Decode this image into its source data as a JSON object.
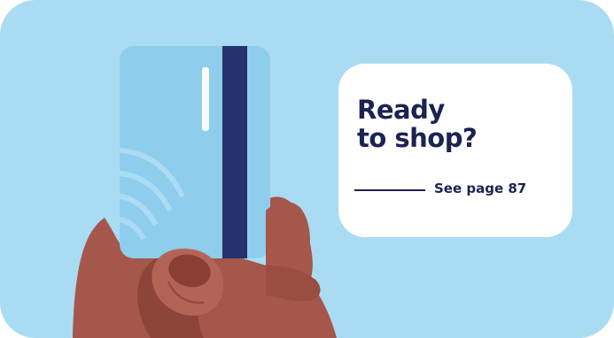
{
  "colors": {
    "background": "#a9dcf3",
    "card_light": "#8fcdec",
    "card_stripe": "#25326b",
    "skin": "#a4574a",
    "skin_shadow": "#7f3b32",
    "callout": "#ffffff",
    "text": "#1c2351"
  },
  "illustration": {
    "icon": "hand-holding-card-icon"
  },
  "callout": {
    "headline_line1": "Ready",
    "headline_line2": "to shop?",
    "reference": "See page 87"
  }
}
